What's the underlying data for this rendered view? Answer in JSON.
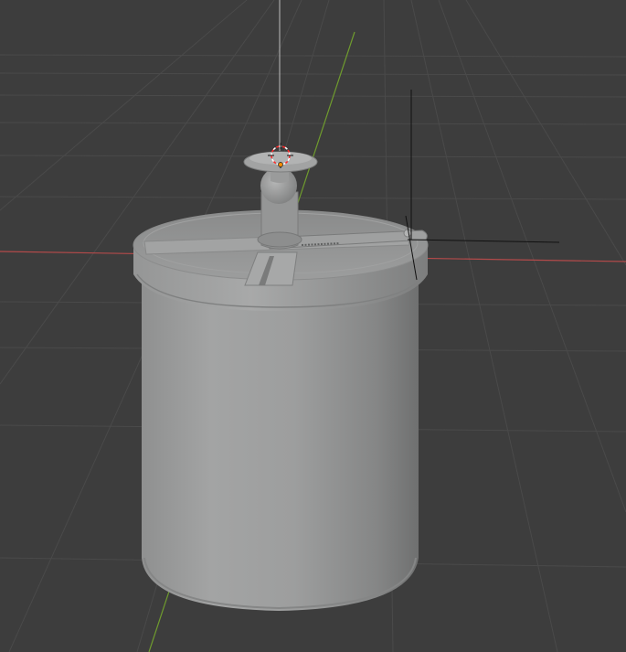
{
  "app": {
    "editor": "3D Viewport",
    "view": "perspective"
  },
  "viewport": {
    "background_color": "#3d3d3d",
    "grid_color": "#4a4a4a",
    "x_axis_color": "#b34a4a",
    "y_axis_color": "#6f9b2e",
    "show_grid": true,
    "show_axes": true
  },
  "scene": {
    "object": {
      "type": "mesh",
      "shape": "cylindrical container with lid, spout and hinge lever",
      "base_color": "#9a9b9b",
      "shadow_color": "#6f7070",
      "highlight_color": "#b4b5b5"
    },
    "overlays": {
      "cursor_3d": {
        "icon": "3d-cursor-icon",
        "colors": [
          "#ff2a2a",
          "#ffffff"
        ]
      },
      "origin": {
        "icon": "origin-dot-icon",
        "color": "#ff8c00"
      },
      "empty_axes": {
        "icon": "empty-axes-icon",
        "color": "#111111"
      }
    }
  }
}
